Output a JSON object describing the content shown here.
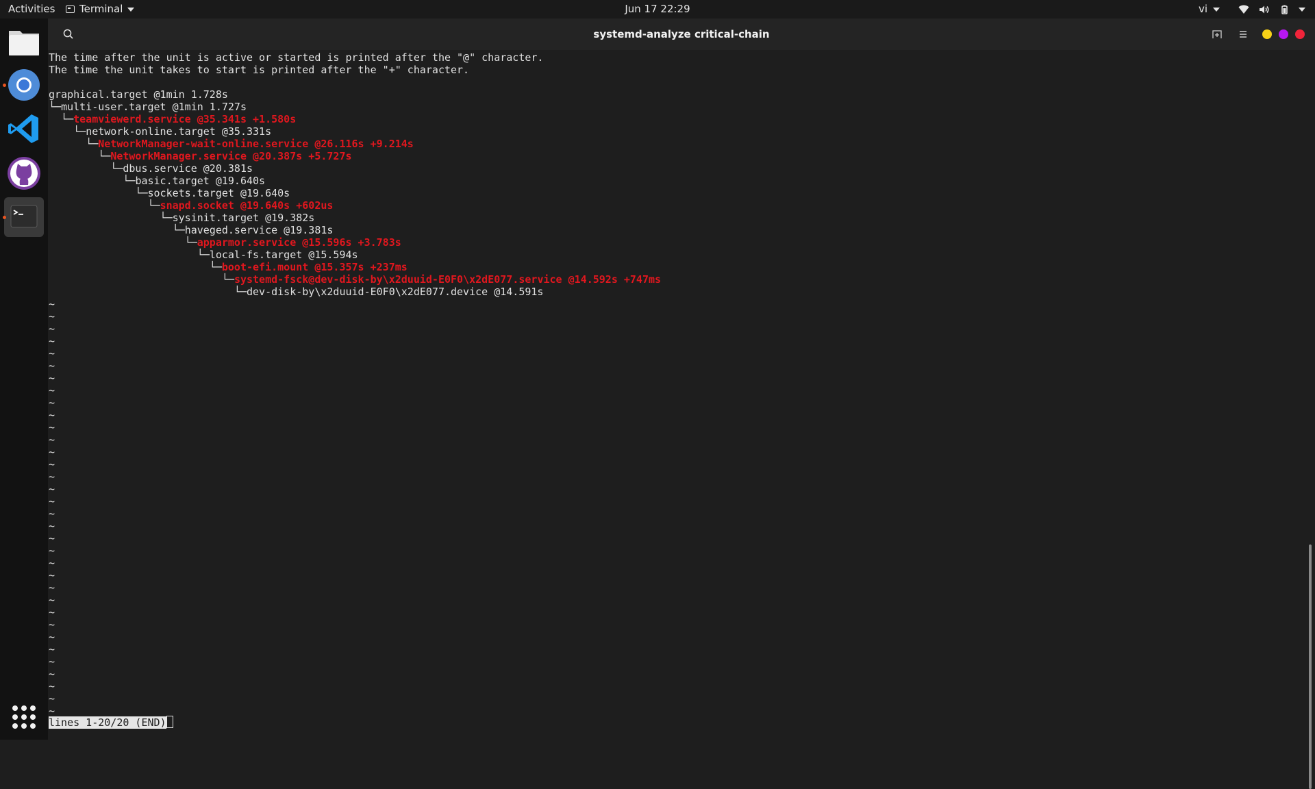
{
  "topbar": {
    "activities": "Activities",
    "app_name": "Terminal",
    "clock": "Jun 17  22:29",
    "input_language": "vi"
  },
  "dock": {
    "items": [
      {
        "name": "files",
        "icon": "files-icon"
      },
      {
        "name": "chromium",
        "icon": "chromium-icon",
        "running": true
      },
      {
        "name": "vscode",
        "icon": "vscode-icon"
      },
      {
        "name": "github-desktop",
        "icon": "github-icon"
      },
      {
        "name": "terminal",
        "icon": "terminal-icon",
        "running": true,
        "active": true
      }
    ],
    "show_apps_icon": "apps-grid-icon"
  },
  "window": {
    "title": "systemd-analyze critical-chain",
    "buttons": {
      "minimize_color": "#f7d117",
      "maximize_color": "#b617f0",
      "close_color": "#f0243a"
    }
  },
  "terminal": {
    "lines": [
      {
        "text": "The time after the unit is active or started is printed after the \"@\" character.",
        "red": false
      },
      {
        "text": "The time the unit takes to start is printed after the \"+\" character.",
        "red": false
      },
      {
        "text": "",
        "red": false
      },
      {
        "text": "graphical.target @1min 1.728s",
        "red": false
      },
      {
        "prefix": "└─",
        "text": "multi-user.target @1min 1.727s",
        "red": false
      },
      {
        "prefix": "  └─",
        "text": "teamviewerd.service @35.341s +1.580s",
        "red": true
      },
      {
        "prefix": "    └─",
        "text": "network-online.target @35.331s",
        "red": false
      },
      {
        "prefix": "      └─",
        "text": "NetworkManager-wait-online.service @26.116s +9.214s",
        "red": true
      },
      {
        "prefix": "        └─",
        "text": "NetworkManager.service @20.387s +5.727s",
        "red": true
      },
      {
        "prefix": "          └─",
        "text": "dbus.service @20.381s",
        "red": false
      },
      {
        "prefix": "            └─",
        "text": "basic.target @19.640s",
        "red": false
      },
      {
        "prefix": "              └─",
        "text": "sockets.target @19.640s",
        "red": false
      },
      {
        "prefix": "                └─",
        "text": "snapd.socket @19.640s +602us",
        "red": true
      },
      {
        "prefix": "                  └─",
        "text": "sysinit.target @19.382s",
        "red": false
      },
      {
        "prefix": "                    └─",
        "text": "haveged.service @19.381s",
        "red": false
      },
      {
        "prefix": "                      └─",
        "text": "apparmor.service @15.596s +3.783s",
        "red": true
      },
      {
        "prefix": "                        └─",
        "text": "local-fs.target @15.594s",
        "red": false
      },
      {
        "prefix": "                          └─",
        "text": "boot-efi.mount @15.357s +237ms",
        "red": true
      },
      {
        "prefix": "                            └─",
        "text": "systemd-fsck@dev-disk-by\\x2duuid-E0F0\\x2dE077.service @14.592s +747ms",
        "red": true
      },
      {
        "prefix": "                              └─",
        "text": "dev-disk-by\\x2duuid-E0F0\\x2dE077.device @14.591s",
        "red": false
      }
    ],
    "filler_marker": "~",
    "filler_count": 34,
    "status": "lines 1-20/20 (END)",
    "red_color": "#e0171e",
    "text_color": "#e0e0e0",
    "background": "#1e1e1e"
  }
}
